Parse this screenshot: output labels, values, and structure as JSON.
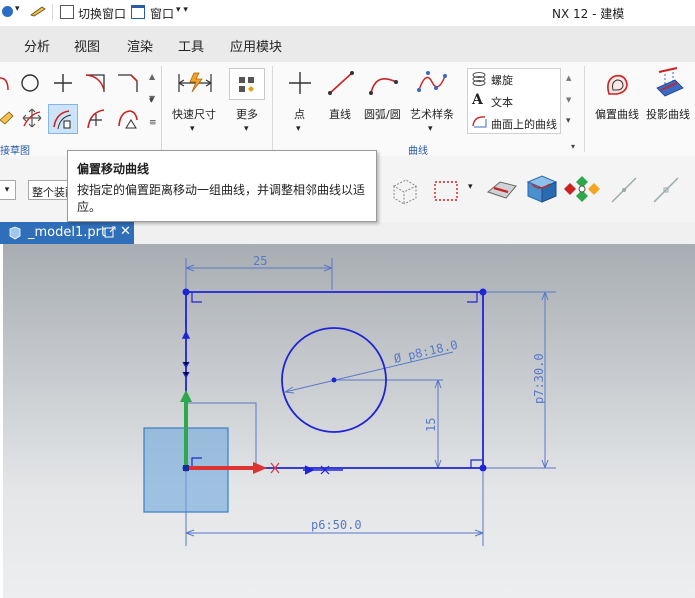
{
  "titlebar": {
    "switch_window": "切换窗口",
    "window_menu": "窗口",
    "app_title": "NX 12 - 建模"
  },
  "menu": {
    "tabs": [
      "分析",
      "视图",
      "渲染",
      "工具",
      "应用模块"
    ]
  },
  "ribbon": {
    "quick_dimension": "快速尺寸",
    "more": "更多",
    "point": "点",
    "line": "直线",
    "arc": "圆弧/圆",
    "spline": "艺术样条",
    "helix": "螺旋",
    "text": "文本",
    "curve_on_surface": "曲面上的曲线",
    "offset_curve": "偏置曲线",
    "projected_curve": "投影曲线",
    "group_direct_sketch": "接草图",
    "group_curve": "曲线"
  },
  "toolbar": {
    "assembly_filter": "整个装配"
  },
  "tooltip": {
    "title": "偏置移动曲线",
    "body": "按指定的偏置距离移动一组曲线，并调整相邻曲线以适应。"
  },
  "doc_tab": {
    "label": "_model1.prt"
  },
  "sketch": {
    "dim_top": "25",
    "dim_diameter": "Ø p8:18.0",
    "dim_height": "p7:30.0",
    "dim_vertical": "15",
    "dim_bottom": "p6:50.0"
  },
  "colors": {
    "ribbon_group_label": "#2857a6",
    "doc_tab": "#2f6fb9",
    "sketch_curve": "#1f24d6",
    "dimension": "#5a78c8"
  }
}
